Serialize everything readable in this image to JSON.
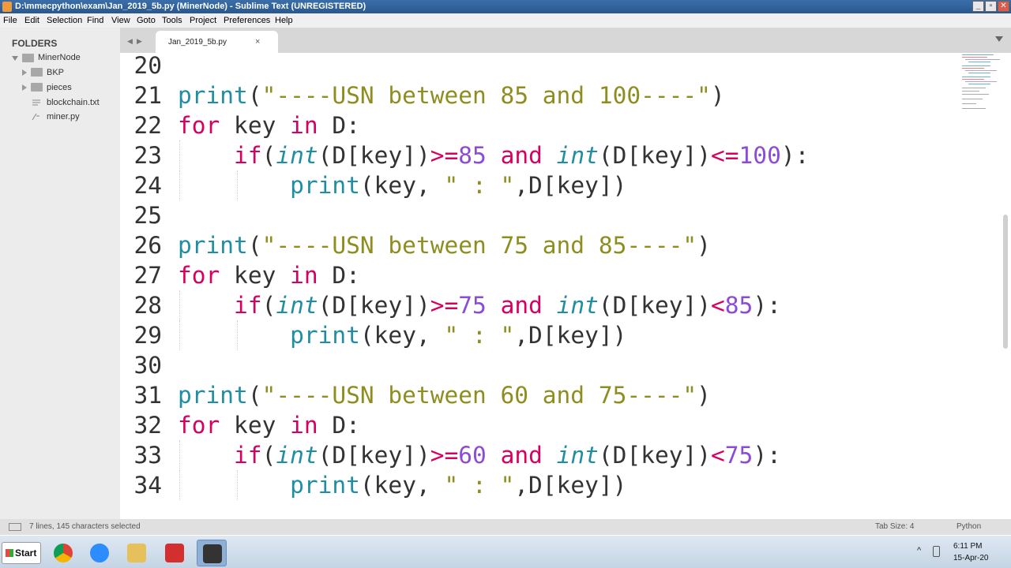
{
  "window": {
    "title": "D:\\mmecpython\\exam\\Jan_2019_5b.py (MinerNode) - Sublime Text (UNREGISTERED)",
    "minimize_label": "_",
    "maximize_label": "▫",
    "close_label": "✕"
  },
  "menu": [
    "File",
    "Edit",
    "Selection",
    "Find",
    "View",
    "Goto",
    "Tools",
    "Project",
    "Preferences",
    "Help"
  ],
  "sidebar": {
    "header": "FOLDERS",
    "root": "MinerNode",
    "items": [
      {
        "label": "BKP",
        "type": "folder"
      },
      {
        "label": "pieces",
        "type": "folder"
      },
      {
        "label": "blockchain.txt",
        "type": "file"
      },
      {
        "label": "miner.py",
        "type": "file"
      }
    ]
  },
  "tabs": [
    {
      "label": "Jan_2019_5b.py",
      "close": "×"
    }
  ],
  "tabbar": {
    "back": "◀",
    "forward": "▶"
  },
  "code": {
    "lines": [
      {
        "n": "20"
      },
      {
        "n": "21",
        "text": "print(\"----USN between 85 and 100----\")"
      },
      {
        "n": "22",
        "text": "for key in D:"
      },
      {
        "n": "23",
        "text": "    if(int(D[key])>=85 and int(D[key])<=100):"
      },
      {
        "n": "24",
        "text": "        print(key, \" : \",D[key])"
      },
      {
        "n": "25"
      },
      {
        "n": "26",
        "text": "print(\"----USN between 75 and 85----\")"
      },
      {
        "n": "27",
        "text": "for key in D:"
      },
      {
        "n": "28",
        "text": "    if(int(D[key])>=75 and int(D[key])<85):"
      },
      {
        "n": "29",
        "text": "        print(key, \" : \",D[key])"
      },
      {
        "n": "30"
      },
      {
        "n": "31",
        "text": "print(\"----USN between 60 and 75----\")"
      },
      {
        "n": "32",
        "text": "for key in D:"
      },
      {
        "n": "33",
        "text": "    if(int(D[key])>=60 and int(D[key])<75):"
      },
      {
        "n": "34",
        "text": "        print(key, \" : \",D[key])"
      }
    ],
    "colors": {
      "function": "#1f8ea3",
      "keyword": "#d7005f",
      "string": "#8e8e20",
      "number": "#8b4bd6"
    }
  },
  "status": {
    "selection": "7 lines, 145 characters selected",
    "tab_size": "Tab Size: 4",
    "syntax": "Python"
  },
  "taskbar": {
    "start": "Start",
    "apps": [
      "chrome-icon",
      "zoom-icon",
      "file-explorer-icon",
      "acrobat-icon",
      "sublime-text-icon"
    ],
    "tray_arrow": "^",
    "time": "6:11 PM",
    "date": "15-Apr-20"
  }
}
